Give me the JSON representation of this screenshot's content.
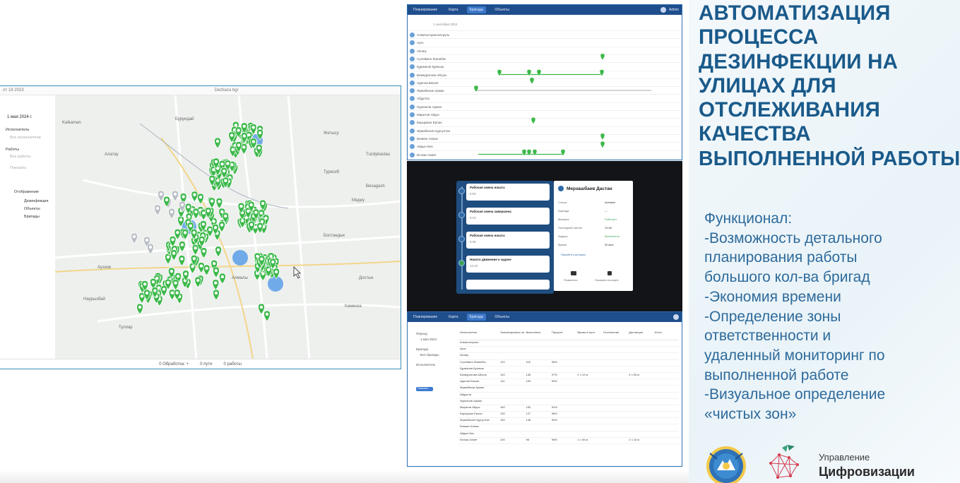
{
  "map_window": {
    "topbar_left": "лт 18 2023",
    "topbar_center": "Dezbaza  bgr",
    "sidebar": {
      "date": "1 мая 2024 г.",
      "group1_label": "Исполнитель",
      "group1_value": "Все исполнители",
      "group2_label": "Работы",
      "group2_value": "Все работы",
      "group2_sub": "Показать",
      "display_label": "Отображение",
      "options": [
        "Дезинфекция",
        "Объекты",
        "Бригады"
      ]
    },
    "map_labels": [
      "Бурундай",
      "Алатау",
      "Жетысу",
      "Турксиб",
      "Медеу",
      "Бостандык",
      "Ауэзов",
      "Алмалы",
      "Наурызбай",
      "Тулпар",
      "Достык",
      "Каменка",
      "Kalkaman",
      "Tuzdybastau",
      "Besagash"
    ],
    "bottom_bar": [
      "0 Обработка: +",
      "0 пути",
      "0 работы"
    ],
    "cursor": "pointer-cursor"
  },
  "gantt_shot": {
    "appbar_tabs": [
      "Планирование",
      "Карта",
      "Бригады",
      "Объекты"
    ],
    "active_tab": "Бригады",
    "user": "Admin",
    "header_date": "1 сентября 2024",
    "rows": [
      "Алматыгорэкопатруль",
      "Ауэз",
      "Аlmaty",
      "Сүлеймен Жанибек",
      "Құрманов Қуаныш",
      "Бекмуратова Айгуль",
      "Адилов Бекзат",
      "Жумабеков Арман",
      "Абдулла",
      "Нурланов Арман",
      "Маратов Айдос",
      "Бауыржан Ерлан",
      "Жумабеков Нұрсултан",
      "Бекжан Алмас",
      "Айдын Бек",
      "Ислам Ахмет"
    ]
  },
  "dark_shot": {
    "timeline_cards": [
      {
        "title": "Рабочая смена начата",
        "sub": "8:00"
      },
      {
        "title": "Рабочая смена завершена",
        "sub": "9:20"
      },
      {
        "title": "Рабочая смена начата",
        "sub": "9:35"
      },
      {
        "title": "Начато движение к задаче",
        "sub": "10:10"
      }
    ],
    "detail_title": "Мерзашбаев Дастан",
    "detail_fields": [
      {
        "label": "Статус",
        "value": "Активен"
      },
      {
        "label": "Бригада",
        "value": "—"
      },
      {
        "label": "Машина",
        "value": "Работает"
      },
      {
        "label": "Последний сигнал",
        "value": "10:45"
      },
      {
        "label": "Задача",
        "value": "Выполнено"
      },
      {
        "label": "Время",
        "value": "30 мин"
      }
    ],
    "detail_link": "Перейти к истории",
    "detail_actions": [
      "Позвонить",
      "Показать на карте"
    ]
  },
  "table_shot": {
    "appbar_tabs": [
      "Планирование",
      "Карта",
      "Бригады",
      "Объекты"
    ],
    "active_tab": "Бригады",
    "side_items": [
      "Период",
      "1 мая 2024",
      "Бригада",
      "Все бригады",
      "Исполнитель",
      "Показать"
    ],
    "headers": [
      "Исполнитель",
      "Запланировано задач",
      "Выполнено",
      "Процент",
      "Время в пути",
      "Отклонения",
      "Дистанция",
      "Итого"
    ],
    "rows": [
      [
        "Алматыгорэко",
        "",
        "",
        "",
        "",
        "",
        "",
        ""
      ],
      [
        "Ауэз",
        "",
        "",
        "",
        "",
        "",
        "",
        ""
      ],
      [
        "Almaty",
        "",
        "",
        "",
        "",
        "",
        "",
        ""
      ],
      [
        "Сүлеймен Жанибек",
        "120",
        "118",
        "98%",
        "",
        "",
        "",
        ""
      ],
      [
        "Құрманов Қуаныш",
        "",
        "",
        "",
        "",
        "",
        "",
        ""
      ],
      [
        "Бекмуратова Айгуль",
        "140",
        "136",
        "97%",
        "2 ч 10 м",
        "",
        "3 ч 05 м",
        ""
      ],
      [
        "Адилов Бекзат",
        "110",
        "109",
        "99%",
        "",
        "",
        "",
        ""
      ],
      [
        "Жумабеков Арман",
        "",
        "",
        "",
        "",
        "",
        "",
        ""
      ],
      [
        "Абдулла",
        "",
        "",
        "",
        "",
        "",
        "",
        ""
      ],
      [
        "Нурланов Арман",
        "",
        "",
        "",
        "",
        "",
        "",
        ""
      ],
      [
        "Маратов Айдос",
        "160",
        "150",
        "94%",
        "",
        "",
        "",
        ""
      ],
      [
        "Бауыржан Ерлан",
        "130",
        "127",
        "98%",
        "",
        "",
        "",
        ""
      ],
      [
        "Жумабеков Нұрсултан",
        "150",
        "148",
        "99%",
        "",
        "",
        "",
        ""
      ],
      [
        "Бекжан Алмас",
        "",
        "",
        "",
        "",
        "",
        "",
        ""
      ],
      [
        "Айдын Бек",
        "",
        "",
        "",
        "",
        "",
        "",
        ""
      ],
      [
        "Ислам Ахмет",
        "100",
        "98",
        "98%",
        "1 ч 40 м",
        "",
        "2 ч 15 м",
        ""
      ]
    ]
  },
  "text_panel": {
    "title_lines": [
      "АВТОМАТИЗАЦИЯ",
      "ПРОЦЕССА",
      "ДЕЗИНФЕКЦИИ НА",
      "УЛИЦАХ ДЛЯ",
      "ОТСЛЕЖИВАНИЯ",
      "КАЧЕСТВА",
      "ВЫПОЛНЕННОЙ РАБОТЫ"
    ],
    "func_lines": [
      "Функционал:",
      "-Возможность детального",
      "планирования работы",
      "большого кол-ва бригад",
      "-Экономия времени",
      "-Определение зоны",
      "ответственности и",
      "удаленный мониторинг по",
      "выполненной работе",
      "-Визуальное определение",
      "«чистых зон»"
    ],
    "org_sub": "Управление",
    "org_name": "Цифровизации"
  },
  "colors": {
    "title": "#1a5a8a",
    "body": "#2e6a9b",
    "appbar": "#1f4e8c",
    "marker": "#3cb84a",
    "water_blob": "#5b9ee6",
    "timeline": "#1f4d80"
  }
}
